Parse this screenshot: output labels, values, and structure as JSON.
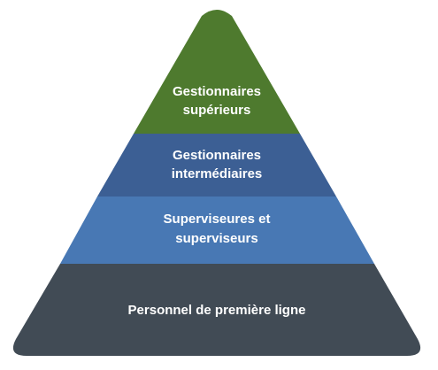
{
  "tiers": [
    {
      "lines": [
        "Gestionnaires",
        "supérieurs"
      ],
      "color": "#4e7a2e"
    },
    {
      "lines": [
        "Gestionnaires",
        "intermédiaires"
      ],
      "color": "#3c5f94"
    },
    {
      "lines": [
        "Superviseures et",
        "superviseurs"
      ],
      "color": "#4878b4"
    },
    {
      "lines": [
        "Personnel de première ligne"
      ],
      "color": "#414b55"
    }
  ]
}
